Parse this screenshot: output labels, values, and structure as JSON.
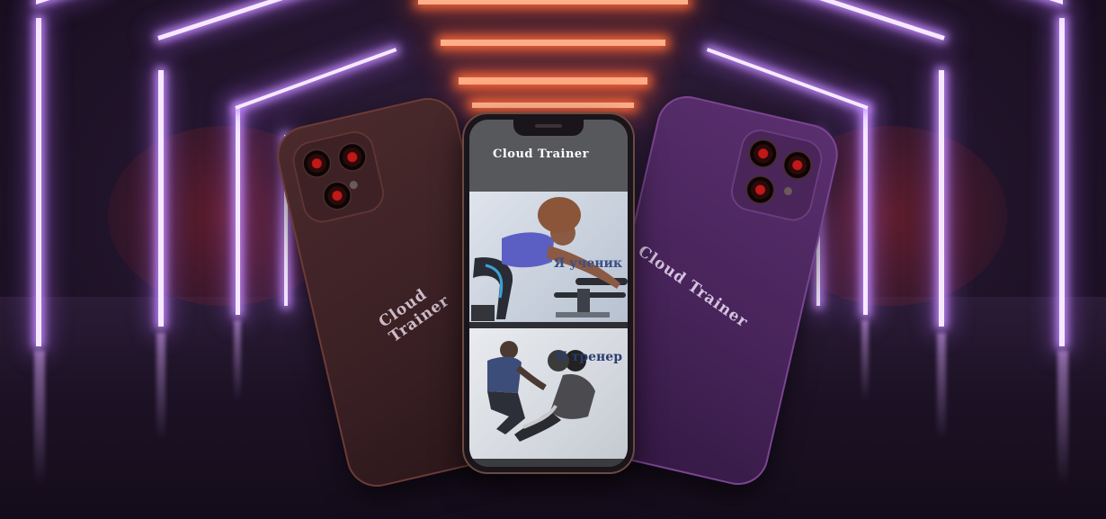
{
  "app": {
    "title": "Cloud Trainer"
  },
  "back_phones": {
    "left_text": "Cloud Trainer",
    "right_text": "Cloud Trainer"
  },
  "options": [
    {
      "label": "Я ученик"
    },
    {
      "label": "Я тренер"
    }
  ],
  "colors": {
    "header_bg": "#57585c",
    "label_color": "#3a4f86",
    "neon": "#f6e9ff",
    "left_phone": "#4b2a2c",
    "right_phone": "#5a2f6e"
  }
}
